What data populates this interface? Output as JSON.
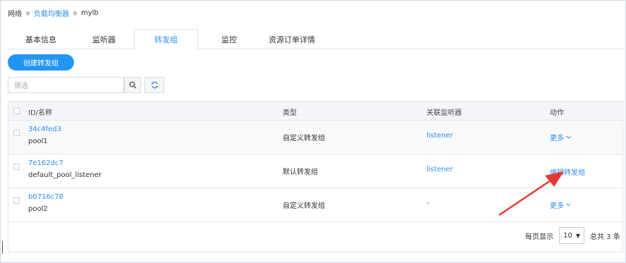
{
  "breadcrumb": {
    "root": "网络",
    "parent": "负载均衡器",
    "current": "mylb"
  },
  "tabs": [
    {
      "label": "基本信息",
      "active": false
    },
    {
      "label": "监听器",
      "active": false
    },
    {
      "label": "转发组",
      "active": true
    },
    {
      "label": "监控",
      "active": false
    },
    {
      "label": "资源订单详情",
      "active": false
    }
  ],
  "toolbar": {
    "create_label": "创建转发组",
    "search_placeholder": "筛选",
    "search_icon": "search-icon",
    "refresh_icon": "refresh-icon"
  },
  "table": {
    "headers": {
      "id_name": "ID/名称",
      "type": "类型",
      "listener": "关联监听器",
      "action": "动作"
    },
    "rows": [
      {
        "id": "34c4fed3",
        "name": "pool1",
        "type": "自定义转发组",
        "listener": "listener",
        "action": "更多"
      },
      {
        "id": "7e162dc7",
        "name": "default_pool_listener",
        "type": "默认转发组",
        "listener": "listener",
        "action": "编辑转发组"
      },
      {
        "id": "b0716c78",
        "name": "pool2",
        "type": "自定义转发组",
        "listener": "-",
        "action": "更多"
      }
    ]
  },
  "pagination": {
    "per_page_label": "每页显示",
    "per_page_value": "10",
    "total_label": "总共 3 条"
  },
  "colors": {
    "primary": "#2196f3",
    "link": "#2d8cf0",
    "arrow": "#e53935"
  }
}
